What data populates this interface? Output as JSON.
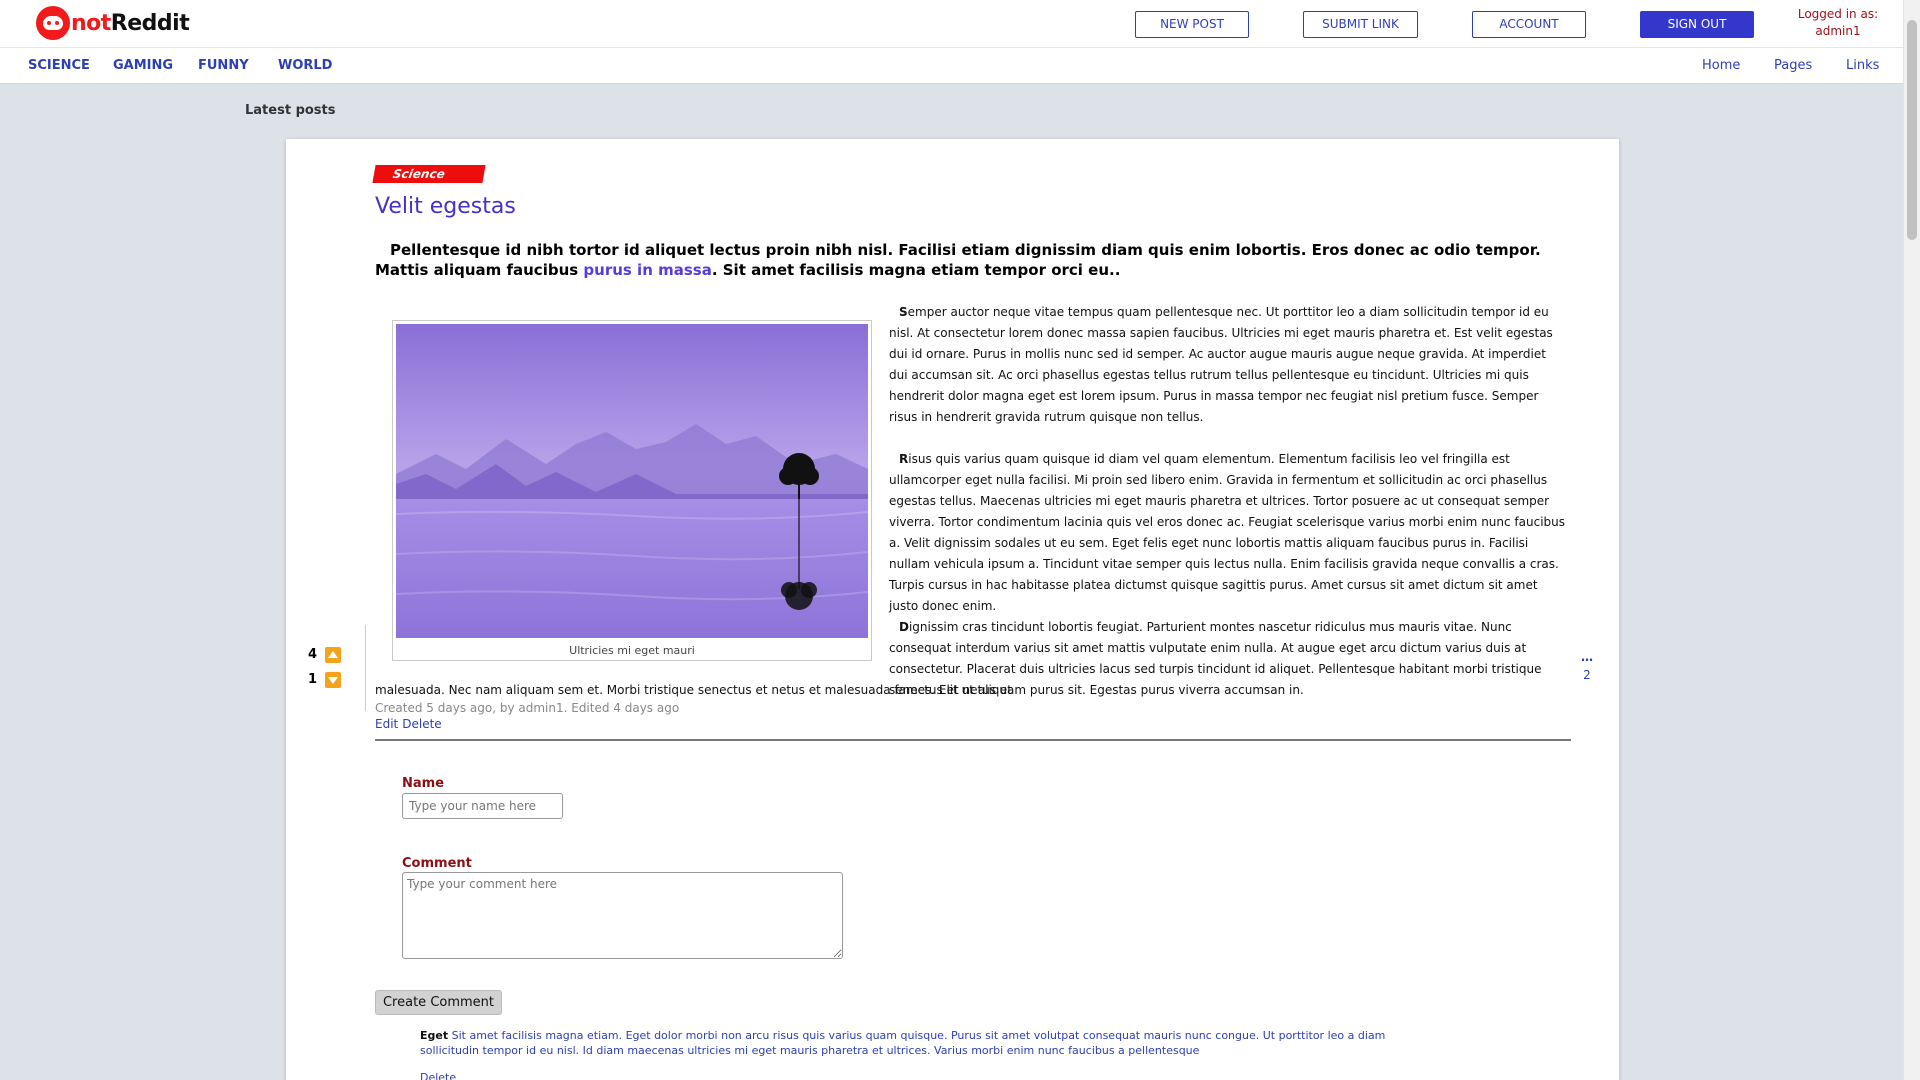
{
  "brand": {
    "prefix": "not",
    "name": "Reddit"
  },
  "header": {
    "new_post": "NEW POST",
    "submit_link": "SUBMIT LINK",
    "account": "ACCOUNT",
    "sign_out": "SIGN OUT",
    "logged_label": "Logged in as:",
    "username": "admin1"
  },
  "nav": {
    "left": [
      "SCIENCE",
      "GAMING",
      "FUNNY",
      "WORLD"
    ],
    "right": [
      "Home",
      "Pages",
      "Links"
    ]
  },
  "section_title": "Latest posts",
  "post": {
    "category": "Science",
    "title": "Velit egestas",
    "lead_text": "Pellentesque id nibh tortor id aliquet lectus proin nibh nisl. Facilisi etiam dignissim diam quis enim lobortis. Eros donec ac odio tempor. Mattis aliquam faucibus ",
    "lead_link": "purus in massa",
    "lead_tail": ". Sit amet facilisis magna etiam tempor orci eu..",
    "image_caption": "Ultricies mi eget mauri",
    "paragraphs": [
      {
        "initial": "S",
        "text": "emper auctor neque vitae tempus quam pellentesque nec. Ut porttitor leo a diam sollicitudin tempor id eu nisl. At consectetur lorem donec massa sapien faucibus. Ultricies mi eget mauris pharetra et. Est velit egestas dui id ornare. Purus in mollis nunc sed id semper. Ac auctor augue mauris augue neque gravida. At imperdiet dui accumsan sit. Ac orci phasellus egestas tellus rutrum tellus pellentesque eu tincidunt. Ultricies mi quis hendrerit dolor magna eget est lorem ipsum. Purus in massa tempor nec feugiat nisl pretium fusce. Semper risus in hendrerit gravida rutrum quisque non tellus."
      },
      {
        "initial": "R",
        "text": "isus quis varius quam quisque id diam vel quam elementum. Elementum facilisis leo vel fringilla est ullamcorper eget nulla facilisi. Mi proin sed libero enim. Gravida in fermentum et sollicitudin ac orci phasellus egestas tellus. Maecenas ultricies mi eget mauris pharetra et ultrices. Tortor posuere ac ut consequat semper viverra. Tortor condimentum lacinia quis vel eros donec ac. Feugiat scelerisque varius morbi enim nunc faucibus a. Velit dignissim sodales ut eu sem. Eget felis eget nunc lobortis mattis aliquam faucibus purus in. Facilisi nullam vehicula ipsum a. Tincidunt vitae semper quis lectus nulla. Enim facilisis gravida neque convallis a cras. Turpis cursus in hac habitasse platea dictumst quisque sagittis purus. Amet cursus sit amet dictum sit amet justo donec enim."
      },
      {
        "initial": "D",
        "text": "ignissim cras tincidunt lobortis feugiat. Parturient montes nascetur ridiculus mus mauris vitae. Nunc consequat interdum varius sit amet mattis vulputate enim nulla. At augue eget arcu dictum varius duis at consectetur. Placerat duis ultricies lacus sed turpis tincidunt id aliquet. Pellentesque habitant morbi tristique senectus et netus et"
      }
    ],
    "tail_text": "malesuada. Nec nam aliquam sem et. Morbi tristique senectus et netus et malesuada fames. Elit ut aliquam purus sit. Egestas purus viverra accumsan in.",
    "meta": "Created 5 days ago, by admin1. Edited 4 days ago",
    "edit": "Edit",
    "delete": "Delete",
    "upvotes": "4",
    "downvotes": "1",
    "comment_count": "2"
  },
  "form": {
    "name_label": "Name",
    "name_placeholder": "Type your name here",
    "comment_label": "Comment",
    "comment_placeholder": "Type your comment here",
    "submit": "Create Comment"
  },
  "comments": [
    {
      "author": "Eget",
      "text": "Sit amet facilisis magna etiam. Eget dolor morbi non arcu risus quis varius quam quisque. Purus sit amet volutpat consequat mauris nunc congue. Ut porttitor leo a diam sollicitudin tempor id eu nisl. Id diam maecenas ultricies mi eget mauris pharetra et ultrices. Varius morbi enim nunc faucibus a pellentesque",
      "delete": "Delete"
    }
  ],
  "colors": {
    "accent": "#2d3fb5",
    "brand_red": "#f21a1a",
    "tag_red": "#ee0d0d",
    "title_purple": "#4a2fc7",
    "vote_orange": "#f5a31a"
  },
  "icons": {
    "logo": "reddit-alien-icon",
    "upvote": "arrow-up-icon",
    "downvote": "arrow-down-icon",
    "comments": "comment-icon"
  }
}
